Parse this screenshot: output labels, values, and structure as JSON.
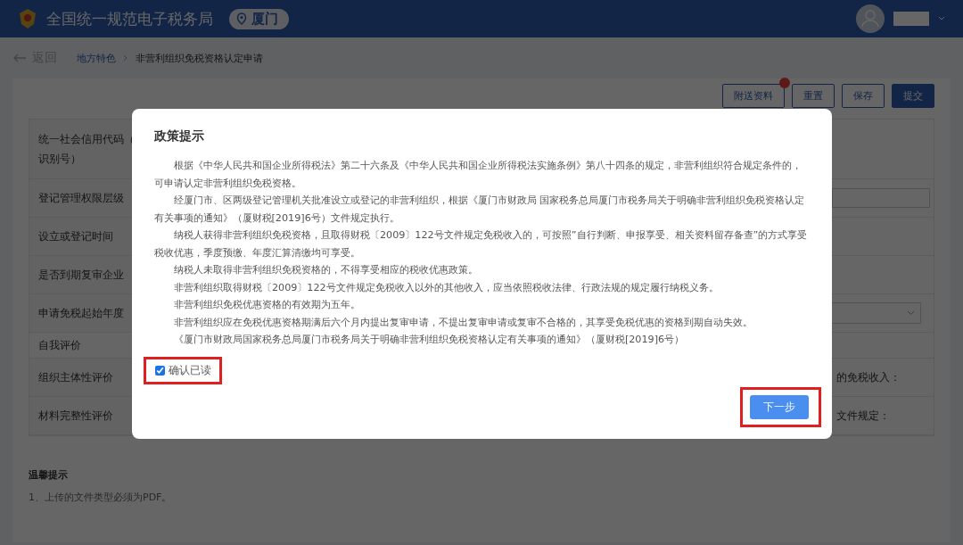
{
  "header": {
    "title": "全国统一规范电子税务局",
    "location": "厦门"
  },
  "breadcrumb": {
    "back": "返回",
    "items": [
      {
        "label": "地方特色",
        "link": true
      },
      {
        "label": "非营利组织免税资格认定申请",
        "link": false
      }
    ]
  },
  "actions": [
    {
      "label": "附送资料",
      "primary": false,
      "badge": true
    },
    {
      "label": "重置",
      "primary": false,
      "badge": false
    },
    {
      "label": "保存",
      "primary": false,
      "badge": false
    },
    {
      "label": "提交",
      "primary": true,
      "badge": false
    }
  ],
  "form": {
    "rows": [
      {
        "label_lines": [
          "统一社会信用代码（",
          "识别号）"
        ],
        "kind": "none"
      },
      {
        "label_lines": [
          "登记管理权限层级"
        ],
        "kind": "input"
      },
      {
        "label_lines": [
          "设立或登记时间"
        ],
        "kind": "none"
      },
      {
        "label_lines": [
          "是否到期复审企业"
        ],
        "kind": "none"
      },
      {
        "label_lines": [
          "申请免税起始年度"
        ],
        "kind": "select"
      },
      {
        "label_lines": [
          "自我评价"
        ],
        "kind": "section"
      },
      {
        "label_lines": [
          "组织主体性评价"
        ],
        "kind": "note",
        "note": "的免税收入："
      },
      {
        "label_lines": [
          "材料完整性评价"
        ],
        "kind": "note",
        "note": "文件规定："
      }
    ]
  },
  "tips": {
    "title": "温馨提示",
    "items": [
      "1、上传的文件类型必须为PDF。"
    ]
  },
  "dialog": {
    "title": "政策提示",
    "paragraphs": [
      "根据《中华人民共和国企业所得税法》第二十六条及《中华人民共和国企业所得税法实施条例》第八十四条的规定，非营利组织符合规定条件的，可申请认定非营利组织免税资格。",
      "经厦门市、区两级登记管理机关批准设立或登记的非营利组织，根据《厦门市财政局 国家税务总局厦门市税务局关于明确非营利组织免税资格认定有关事项的通知》（厦财税[2019]6号）文件规定执行。",
      "纳税人获得非营利组织免税资格，且取得财税〔2009〕122号文件规定免税收入的，可按照”自行判断、申报享受、相关资料留存备查”的方式享受税收优惠，季度预缴、年度汇算清缴均可享受。",
      "纳税人未取得非营利组织免税资格的，不得享受相应的税收优惠政策。",
      "非营利组织取得财税〔2009〕122号文件规定免税收入以外的其他收入，应当依照税收法律、行政法规的规定履行纳税义务。",
      "非营利组织免税优惠资格的有效期为五年。",
      "非营利组织应在免税优惠资格期满后六个月内提出复审申请，不提出复审申请或复审不合格的，其享受免税优惠的资格到期自动失效。",
      "《厦门市财政局国家税务总局厦门市税务局关于明确非营利组织免税资格认定有关事项的通知》（厦财税[2019]6号）"
    ],
    "confirm": {
      "label": "确认已读",
      "checked": true
    },
    "next_button": "下一步"
  }
}
